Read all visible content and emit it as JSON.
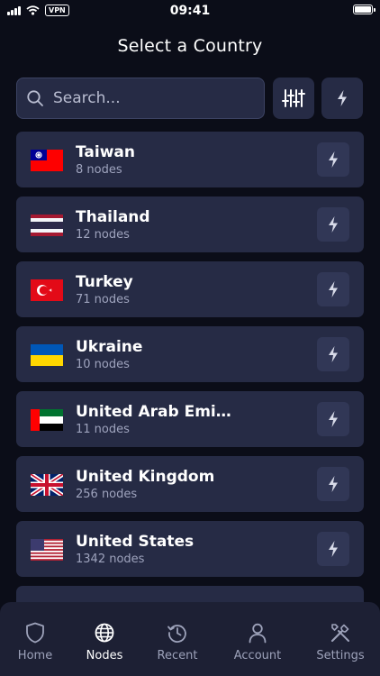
{
  "status_bar": {
    "time": "09:41",
    "vpn": "VPN"
  },
  "header": {
    "title": "Select a Country"
  },
  "search": {
    "placeholder": "Search..."
  },
  "icons": {
    "search": "search-icon",
    "filter": "sliders-icon",
    "quick_connect": "lightning-icon",
    "row_connect": "lightning-icon"
  },
  "countries": [
    {
      "name": "Taiwan",
      "nodes": "8 nodes"
    },
    {
      "name": "Thailand",
      "nodes": "12 nodes"
    },
    {
      "name": "Turkey",
      "nodes": "71 nodes"
    },
    {
      "name": "Ukraine",
      "nodes": "10 nodes"
    },
    {
      "name": "United Arab Emirates",
      "nodes": "11 nodes"
    },
    {
      "name": "United Kingdom",
      "nodes": "256 nodes"
    },
    {
      "name": "United States",
      "nodes": "1342 nodes"
    }
  ],
  "tabs": [
    {
      "label": "Home",
      "icon": "shield-icon",
      "active": false
    },
    {
      "label": "Nodes",
      "icon": "globe-icon",
      "active": true
    },
    {
      "label": "Recent",
      "icon": "history-icon",
      "active": false
    },
    {
      "label": "Account",
      "icon": "user-icon",
      "active": false
    },
    {
      "label": "Settings",
      "icon": "tools-icon",
      "active": false
    }
  ],
  "colors": {
    "background": "#0b0d18",
    "card": "#262b45",
    "button": "#313756",
    "tab_bar": "#1d2034",
    "muted_text": "#9ea3bd"
  }
}
